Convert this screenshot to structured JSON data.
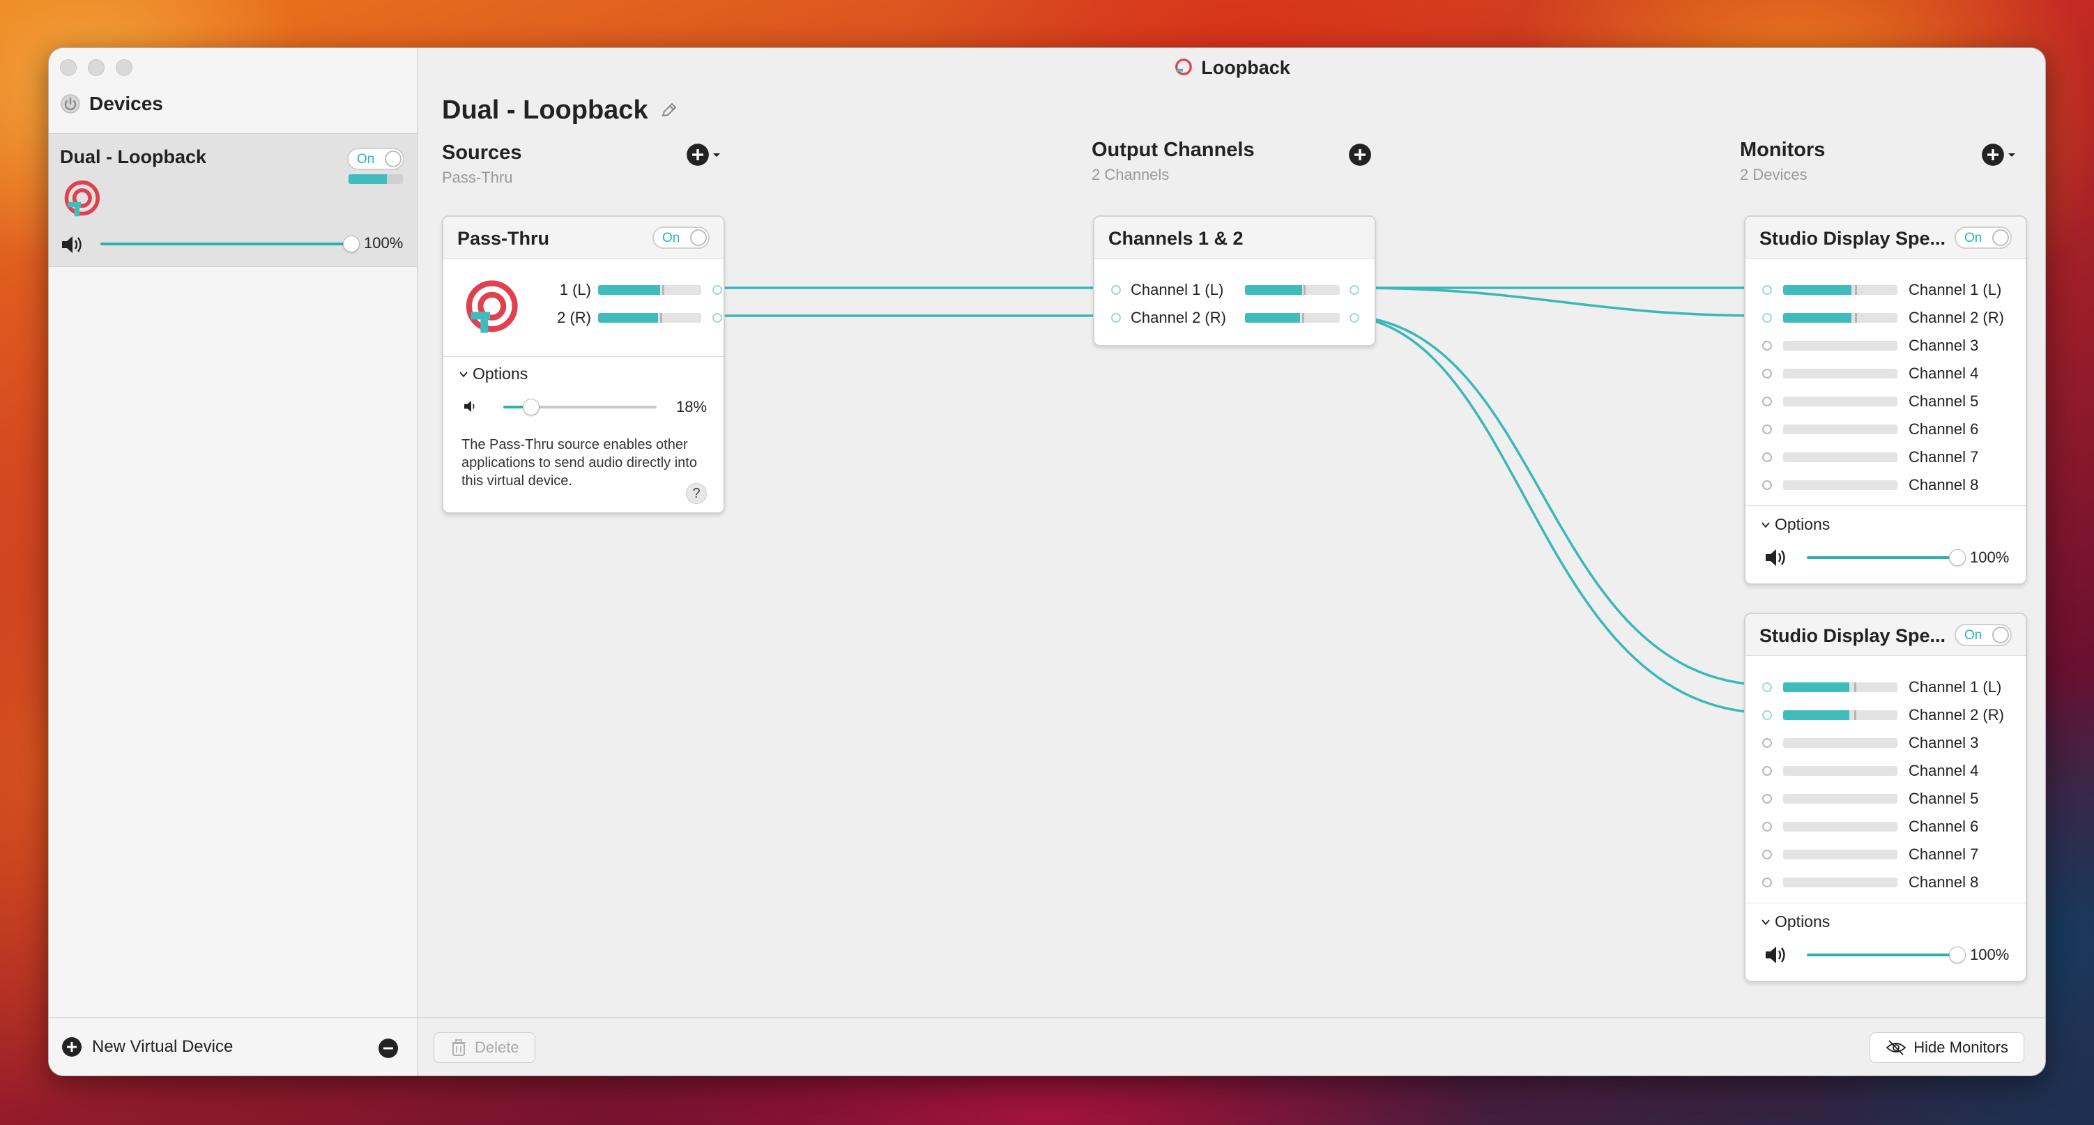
{
  "window": {
    "title": "Loopback"
  },
  "sidebar": {
    "title": "Devices",
    "device": {
      "name": "Dual - Loopback",
      "toggle_label": "On",
      "volume": 1.0,
      "volume_label": "100%",
      "level": 0.7
    },
    "new_device_label": "New Virtual Device"
  },
  "main": {
    "title": "Dual - Loopback"
  },
  "columns": {
    "sources": {
      "title": "Sources",
      "subtitle": "Pass-Thru"
    },
    "outputs": {
      "title": "Output Channels",
      "subtitle": "2 Channels"
    },
    "monitors": {
      "title": "Monitors",
      "subtitle": "2 Devices"
    }
  },
  "passthru": {
    "title": "Pass-Thru",
    "toggle_label": "On",
    "channels": [
      {
        "label": "1 (L)",
        "level": 0.6,
        "peak": 0.62
      },
      {
        "label": "2 (R)",
        "level": 0.58,
        "peak": 0.6
      }
    ],
    "options_label": "Options",
    "volume": 0.18,
    "volume_label": "18%",
    "description": "The Pass-Thru source enables other applications to send audio directly into this virtual device.",
    "help_label": "?"
  },
  "output_card": {
    "title": "Channels 1 & 2",
    "channels": [
      {
        "label": "Channel 1 (L)",
        "level": 0.6,
        "peak": 0.62
      },
      {
        "label": "Channel 2 (R)",
        "level": 0.58,
        "peak": 0.6
      }
    ]
  },
  "monitor_cards": [
    {
      "title": "Studio Display Spe...",
      "toggle_label": "On",
      "options_label": "Options",
      "volume": 1.0,
      "volume_label": "100%",
      "channels": [
        {
          "label": "Channel 1 (L)",
          "level": 0.6,
          "peak": 0.63
        },
        {
          "label": "Channel 2 (R)",
          "level": 0.6,
          "peak": 0.63
        },
        {
          "label": "Channel 3",
          "level": 0,
          "peak": 0
        },
        {
          "label": "Channel 4",
          "level": 0,
          "peak": 0
        },
        {
          "label": "Channel 5",
          "level": 0,
          "peak": 0
        },
        {
          "label": "Channel 6",
          "level": 0,
          "peak": 0
        },
        {
          "label": "Channel 7",
          "level": 0,
          "peak": 0
        },
        {
          "label": "Channel 8",
          "level": 0,
          "peak": 0
        }
      ]
    },
    {
      "title": "Studio Display Spe...",
      "toggle_label": "On",
      "options_label": "Options",
      "volume": 1.0,
      "volume_label": "100%",
      "channels": [
        {
          "label": "Channel 1 (L)",
          "level": 0.58,
          "peak": 0.62
        },
        {
          "label": "Channel 2 (R)",
          "level": 0.58,
          "peak": 0.62
        },
        {
          "label": "Channel 3",
          "level": 0,
          "peak": 0
        },
        {
          "label": "Channel 4",
          "level": 0,
          "peak": 0
        },
        {
          "label": "Channel 5",
          "level": 0,
          "peak": 0
        },
        {
          "label": "Channel 6",
          "level": 0,
          "peak": 0
        },
        {
          "label": "Channel 7",
          "level": 0,
          "peak": 0
        },
        {
          "label": "Channel 8",
          "level": 0,
          "peak": 0
        }
      ]
    }
  ],
  "bottom": {
    "delete_label": "Delete",
    "hide_monitors_label": "Hide Monitors"
  },
  "colors": {
    "accent": "#3fbcbc",
    "wire": "#3ab8b8",
    "logo_red": "#e0414f"
  },
  "icons": {
    "app": "loopback-logo-icon",
    "add": "plus-circle-icon",
    "remove": "minus-circle-icon",
    "speaker": "speaker-icon",
    "trash": "trash-icon",
    "eye_slash": "eye-slash-icon",
    "pencil": "pencil-icon",
    "chevron": "chevron-down-icon"
  }
}
